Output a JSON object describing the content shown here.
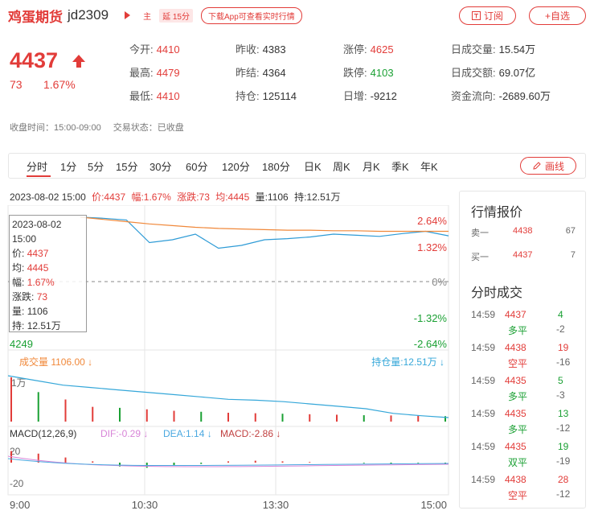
{
  "header": {
    "title": "鸡蛋期货",
    "code": "jd2309",
    "main_badge": "主",
    "delay_badge": "延 15分",
    "app_pill": "下载App可查看实时行情",
    "subscribe": "订阅",
    "watchlist": "+自选"
  },
  "price": {
    "last": "4437",
    "change": "73",
    "change_pct": "1.67%"
  },
  "stats": [
    {
      "k": "今开:",
      "v": "4410",
      "color": "red"
    },
    {
      "k": "昨收:",
      "v": "4383",
      "color": "gray"
    },
    {
      "k": "涨停:",
      "v": "4625",
      "color": "red"
    },
    {
      "k": "日成交量:",
      "v": "15.54万",
      "color": "gray"
    },
    {
      "k": "最高:",
      "v": "4479",
      "color": "red"
    },
    {
      "k": "昨结:",
      "v": "4364",
      "color": "gray"
    },
    {
      "k": "跌停:",
      "v": "4103",
      "color": "green"
    },
    {
      "k": "日成交额:",
      "v": "69.07亿",
      "color": "gray"
    },
    {
      "k": "最低:",
      "v": "4410",
      "color": "red"
    },
    {
      "k": "持仓:",
      "v": "125114",
      "color": "gray"
    },
    {
      "k": "日增:",
      "v": "-9212",
      "color": "gray"
    },
    {
      "k": "资金流向:",
      "v": "-2689.60万",
      "color": "gray"
    }
  ],
  "status": {
    "time": "收盘时间：15:00-09:00",
    "state": "交易状态：已收盘"
  },
  "tabs": [
    "分时",
    "1分",
    "5分",
    "15分",
    "30分",
    "60分",
    "120分",
    "180分",
    "日K",
    "周K",
    "月K",
    "季K",
    "年K"
  ],
  "draw_button": "画线",
  "info_line": {
    "datetime": "2023-08-02 15:00",
    "price": "价:4437",
    "amp": "幅:1.67%",
    "change": "涨跌:73",
    "avg": "均:4445",
    "volume": "量:1106",
    "oi": "持:12.51万"
  },
  "tooltip": {
    "date": "2023-08-02",
    "time": "15:00",
    "price": "4437",
    "avg": "4445",
    "amp": "1.67%",
    "change": "73",
    "volume": "1106",
    "oi": "12.51万",
    "labels": {
      "price": "价:",
      "avg": "均:",
      "amp": "幅:",
      "change": "涨跌:",
      "volume": "量:",
      "oi": "持:"
    }
  },
  "chart_data": [
    {
      "type": "line",
      "title": "",
      "x": [
        "9:00",
        "10:30",
        "13:30",
        "15:00"
      ],
      "series": [
        {
          "name": "价",
          "values": [
            4470,
            4468,
            4465,
            4425,
            4430,
            4440,
            4415,
            4420,
            4430,
            4432,
            4435,
            4440,
            4438,
            4436,
            4441,
            4445,
            4437
          ]
        },
        {
          "name": "均",
          "values": [
            4470,
            4466,
            4462,
            4458,
            4455,
            4452,
            4450,
            4449,
            4448,
            4447,
            4447,
            4446,
            4446,
            4445,
            4445,
            4445,
            4445
          ]
        }
      ],
      "y_left_ticks": [
        "4249"
      ],
      "y_right_ticks": [
        "2.64%",
        "1.32%",
        "0%",
        "-1.32%",
        "-2.64%"
      ],
      "ylim": [
        4249,
        4477
      ]
    },
    {
      "type": "bar",
      "title": "成交量",
      "legend": {
        "volume": "成交量 1106.00",
        "oi": "持仓量:12.51万"
      },
      "y_tick": "1万",
      "volume": [
        9000,
        6000,
        4500,
        3000,
        2800,
        2500,
        2200,
        2000,
        1800,
        1700,
        1600,
        1500,
        1400,
        1300,
        1250,
        1200,
        1106
      ],
      "oi": [
        134000,
        133000,
        132000,
        131500,
        131000,
        130500,
        130000,
        129500,
        129000,
        128800,
        128500,
        128000,
        127500,
        127000,
        126000,
        125500,
        125114
      ]
    },
    {
      "type": "bar",
      "title": "MACD(12,26,9)",
      "legend": {
        "dif": "DIF:-0.29",
        "dea": "DEA:1.14",
        "macd": "MACD:-2.86"
      },
      "y_ticks": [
        "20",
        "-20"
      ],
      "macd": [
        18,
        14,
        8,
        2,
        -6,
        -8,
        -5,
        -2,
        2,
        3,
        2,
        1,
        0,
        -1,
        -2,
        -1,
        -2.86
      ]
    }
  ],
  "x_labels": [
    "9:00",
    "10:30",
    "13:30",
    "15:00"
  ],
  "quote": {
    "title": "行情报价",
    "sell_label": "卖一",
    "sell_price": "4438",
    "sell_vol": "67",
    "buy_label": "买一",
    "buy_price": "4437",
    "buy_vol": "7"
  },
  "deals_title": "分时成交",
  "deals": [
    {
      "time": "14:59",
      "price": "4437",
      "price_color": "red",
      "qty": "4",
      "qty_color": "green",
      "type": "多平",
      "type_color": "green",
      "delta": "-2"
    },
    {
      "time": "14:59",
      "price": "4438",
      "price_color": "red",
      "qty": "19",
      "qty_color": "red",
      "type": "空平",
      "type_color": "red",
      "delta": "-16"
    },
    {
      "time": "14:59",
      "price": "4435",
      "price_color": "red",
      "qty": "5",
      "qty_color": "green",
      "type": "多平",
      "type_color": "green",
      "delta": "-3"
    },
    {
      "time": "14:59",
      "price": "4435",
      "price_color": "red",
      "qty": "13",
      "qty_color": "green",
      "type": "多平",
      "type_color": "green",
      "delta": "-12"
    },
    {
      "time": "14:59",
      "price": "4435",
      "price_color": "red",
      "qty": "19",
      "qty_color": "green",
      "type": "双平",
      "type_color": "green",
      "delta": "-19"
    },
    {
      "time": "14:59",
      "price": "4438",
      "price_color": "red",
      "qty": "28",
      "qty_color": "red",
      "type": "空平",
      "type_color": "red",
      "delta": "-12"
    }
  ],
  "colors": {
    "red": "#e23c39",
    "green": "#1aa033",
    "price_line": "#2e9bd6",
    "avg_line": "#f0883a",
    "oi_line": "#35a7d9"
  }
}
